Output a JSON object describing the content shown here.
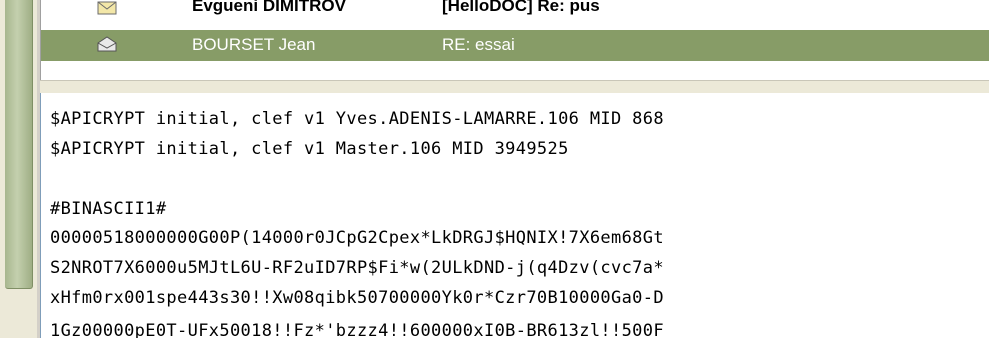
{
  "messages": [
    {
      "sender": "Evgueni DIMITROV",
      "subject": "[HelloDOC] Re: pus",
      "icon": "envelope-unread-icon",
      "selected": false
    },
    {
      "sender": "BOURSET Jean",
      "subject": "RE: essai",
      "icon": "envelope-open-icon",
      "selected": true
    }
  ],
  "body_lines": [
    "$APICRYPT initial, clef v1 Yves.ADENIS-LAMARRE.106 MID 868",
    "$APICRYPT initial, clef v1 Master.106 MID 3949525",
    "",
    "#BINASCII1#",
    "00000518000000G00P(14000r0JCpG2Cpex*LkDRGJ$HQNIX!7X6em68Gt",
    "S2NROT7X6000u5MJtL6U-RF2uID7RP$Fi*w(2ULkDND-j(q4Dzv(cvc7a*",
    "xHfm0rx001spe443s30!!Xw08qibk50700000Yk0r*Czr70B10000Ga0-D",
    "1Gz00000pE0T-UFx50018!!Fz*'bzzz4!!600000xI0B-BR613zl!!500F"
  ],
  "colors": {
    "selected_row": "#879c67",
    "sidebar": "#b4c29b"
  }
}
